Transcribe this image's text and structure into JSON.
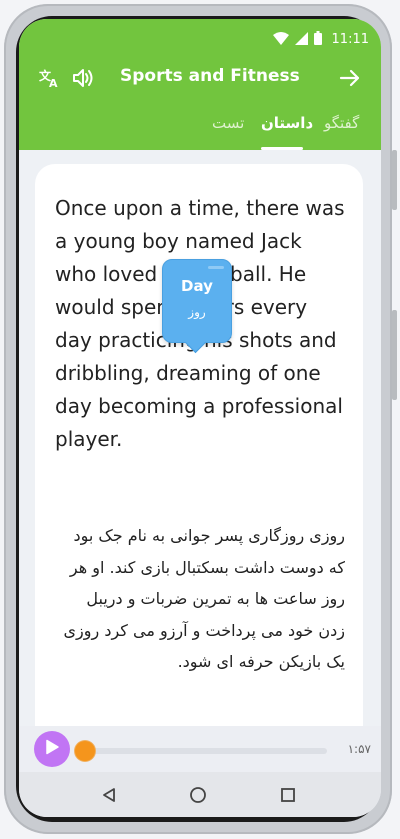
{
  "status_bar": {
    "time": "11:11"
  },
  "header": {
    "title": "Sports and Fitness",
    "translate_icon": "translate-icon",
    "speaker_icon": "speaker-icon",
    "forward_icon": "arrow-right-icon"
  },
  "tabs": [
    {
      "label": "گفتگو",
      "active": false
    },
    {
      "label": "داستان",
      "active": true
    },
    {
      "label": "تست",
      "active": false
    }
  ],
  "story": {
    "english": "Once upon a time, there was a young boy named Jack who loved basketball. He would spend hours every day practicing his shots and dribbling, dreaming of one day becoming a professional player.",
    "persian": "روزی روزگاری پسر جوانی به نام جک بود که دوست داشت بسکتبال بازی کند. او هر روز ساعت ها به تمرین ضربات و دریبل زدن خود می پرداخت و آرزو می کرد روزی یک بازیکن حرفه ای شود."
  },
  "tooltip": {
    "word": "Day",
    "translation": "روز"
  },
  "player": {
    "time": "۱:۵۷",
    "progress": 0.0
  },
  "nav": {
    "back_icon": "back-triangle-icon",
    "home_icon": "home-circle-icon",
    "recents_icon": "recents-square-icon"
  },
  "colors": {
    "header": "#72c53e",
    "play_button": "#c175f4",
    "progress_knob": "#f5951c",
    "tooltip": "#5bb0ef"
  }
}
